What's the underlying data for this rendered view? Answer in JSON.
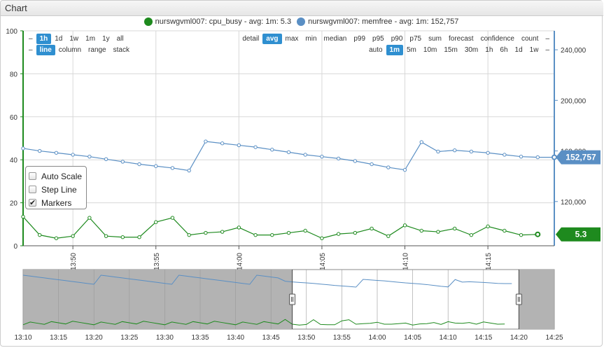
{
  "header": {
    "title": "Chart"
  },
  "legend": [
    {
      "label": "nurswgvml007: cpu_busy - avg: 1m: 5.3",
      "color": "#1e8a1e"
    },
    {
      "label": "nurswgvml007: memfree - avg: 1m: 152,757",
      "color": "#5a8fc4"
    }
  ],
  "controls": {
    "row1_left": [
      "–",
      "1h",
      "1d",
      "1w",
      "1m",
      "1y",
      "all"
    ],
    "row1_left_active": "1h",
    "row2_left": [
      "–",
      "line",
      "column",
      "range",
      "stack"
    ],
    "row2_left_active": "line",
    "row1_right": [
      "detail",
      "avg",
      "max",
      "min",
      "median",
      "p99",
      "p95",
      "p90",
      "p75",
      "sum",
      "forecast",
      "confidence",
      "count",
      "–"
    ],
    "row1_right_active": "avg",
    "row2_right": [
      "auto",
      "1m",
      "5m",
      "10m",
      "15m",
      "30m",
      "1h",
      "6h",
      "1d",
      "1w",
      "–"
    ],
    "row2_right_active": "1m"
  },
  "options": [
    {
      "label": "Auto Scale",
      "checked": false
    },
    {
      "label": "Step Line",
      "checked": false
    },
    {
      "label": "Markers",
      "checked": true
    }
  ],
  "badges": {
    "memfree": "152,757",
    "cpu": "5.3"
  },
  "colors": {
    "cpu": "#1e8a1e",
    "mem": "#5a8fc4",
    "accent": "#2f8fd0"
  },
  "chart_data": {
    "type": "line",
    "x_unit": "minutes",
    "main_x_range": [
      "13:47",
      "14:19"
    ],
    "main_x_ticks": [
      "13:50",
      "13:55",
      "14:00",
      "14:05",
      "14:10",
      "14:15"
    ],
    "left_axis": {
      "ylim": [
        0,
        100
      ],
      "ticks": [
        "0",
        "20",
        "40",
        "60",
        "80",
        "100"
      ]
    },
    "right_axis": {
      "ylim": [
        85000,
        255000
      ],
      "ticks": [
        "120,000",
        "160,000",
        "200,000",
        "240,000"
      ]
    },
    "series": [
      {
        "name": "nurswgvml007: cpu_busy - avg: 1m",
        "axis": "left",
        "x": [
          "13:47",
          "13:48",
          "13:49",
          "13:50",
          "13:51",
          "13:52",
          "13:53",
          "13:54",
          "13:55",
          "13:56",
          "13:57",
          "13:58",
          "13:59",
          "14:00",
          "14:01",
          "14:02",
          "14:03",
          "14:04",
          "14:05",
          "14:06",
          "14:07",
          "14:08",
          "14:09",
          "14:10",
          "14:11",
          "14:12",
          "14:13",
          "14:14",
          "14:15",
          "14:16",
          "14:17",
          "14:18"
        ],
        "values": [
          13.5,
          5,
          3.5,
          4.5,
          13,
          4.5,
          4,
          4,
          11,
          13,
          5,
          6,
          6.5,
          8.5,
          5,
          5,
          6,
          7,
          3.5,
          5.5,
          6,
          8,
          4.5,
          9.5,
          7,
          6.5,
          8,
          5,
          9,
          7,
          5,
          5.3
        ]
      },
      {
        "name": "nurswgvml007: memfree - avg: 1m",
        "axis": "right",
        "x": [
          "13:47",
          "13:48",
          "13:49",
          "13:50",
          "13:51",
          "13:52",
          "13:53",
          "13:54",
          "13:55",
          "13:56",
          "13:57",
          "13:58",
          "13:59",
          "14:00",
          "14:01",
          "14:02",
          "14:03",
          "14:04",
          "14:05",
          "14:06",
          "14:07",
          "14:08",
          "14:09",
          "14:10",
          "14:11",
          "14:12",
          "14:13",
          "14:14",
          "14:15",
          "14:16",
          "14:17",
          "14:18",
          "14:19"
        ],
        "values": [
          162000,
          160000,
          158500,
          157000,
          155500,
          153500,
          151500,
          149500,
          148000,
          146500,
          144500,
          167500,
          166000,
          164500,
          163000,
          161000,
          159000,
          157000,
          155500,
          154000,
          152000,
          149500,
          147000,
          145000,
          167000,
          159500,
          160500,
          159500,
          158500,
          157000,
          155500,
          155000,
          155000
        ]
      }
    ],
    "navigator": {
      "x_ticks": [
        "13:10",
        "13:15",
        "13:20",
        "13:25",
        "13:30",
        "13:35",
        "13:40",
        "13:45",
        "13:50",
        "13:55",
        "14:00",
        "14:05",
        "14:10",
        "14:15",
        "14:20",
        "14:25"
      ],
      "selected_range": [
        "13:48",
        "14:20"
      ]
    }
  }
}
